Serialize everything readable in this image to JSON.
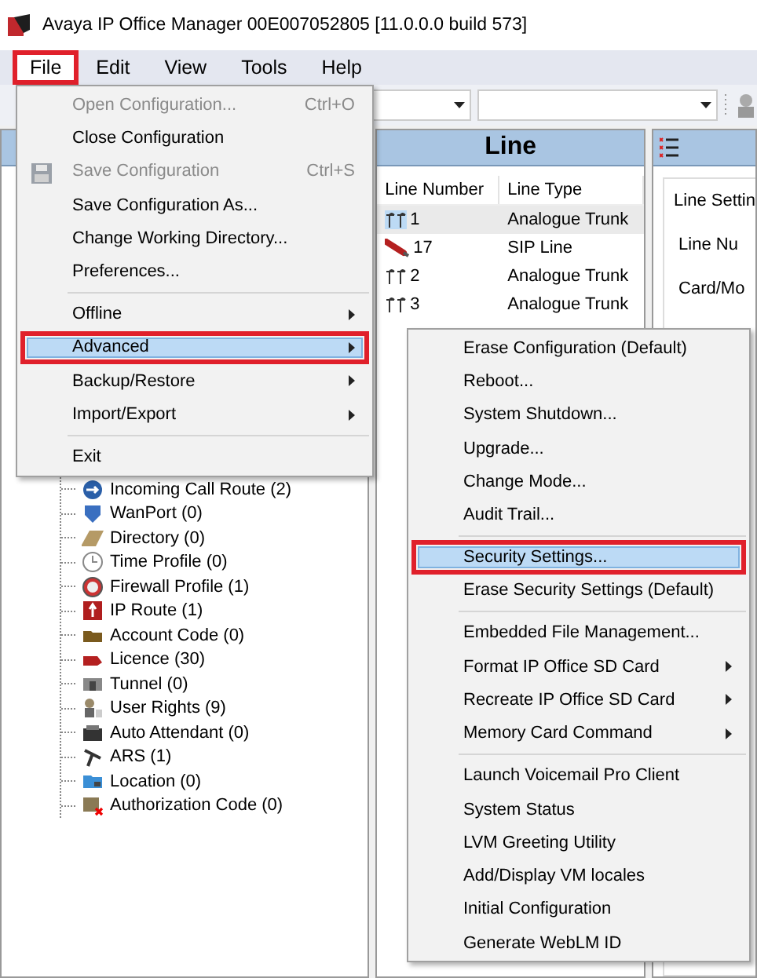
{
  "window": {
    "title": "Avaya IP Office Manager 00E007052805 [11.0.0.0 build 573]"
  },
  "menubar": [
    {
      "label": "File",
      "selected": true,
      "annotated": true
    },
    {
      "label": "Edit",
      "selected": false,
      "annotated": false
    },
    {
      "label": "View",
      "selected": false,
      "annotated": false
    },
    {
      "label": "Tools",
      "selected": false,
      "annotated": false
    },
    {
      "label": "Help",
      "selected": false,
      "annotated": false
    }
  ],
  "tree": {
    "items": [
      "Incoming Call Route (2)",
      "WanPort (0)",
      "Directory (0)",
      "Time Profile (0)",
      "Firewall Profile (1)",
      "IP Route (1)",
      "Account Code (0)",
      "Licence (30)",
      "Tunnel (0)",
      "User Rights (9)",
      "Auto Attendant (0)",
      "ARS (1)",
      "Location (0)",
      "Authorization Code (0)"
    ]
  },
  "line_panel": {
    "title": "Line",
    "columns": [
      "Line Number",
      "Line Type"
    ],
    "rows": [
      {
        "number": "1",
        "type": "Analogue Trunk",
        "kind": "analogue",
        "selected": true
      },
      {
        "number": "17",
        "type": "SIP Line",
        "kind": "sip",
        "selected": false
      },
      {
        "number": "2",
        "type": "Analogue Trunk",
        "kind": "analogue",
        "selected": false
      },
      {
        "number": "3",
        "type": "Analogue Trunk",
        "kind": "analogue",
        "selected": false
      }
    ]
  },
  "detail_panel": {
    "group_title": "Line Settin",
    "labels": [
      "Line Nu",
      "Card/Mo"
    ]
  },
  "file_menu": [
    {
      "kind": "item",
      "label": "Open Configuration...",
      "shortcut": "Ctrl+O",
      "disabled": true,
      "submenu": false,
      "selected": false,
      "annotated": false
    },
    {
      "kind": "item",
      "label": "Close Configuration",
      "disabled": false,
      "submenu": false,
      "selected": false,
      "annotated": false
    },
    {
      "kind": "icon_item",
      "label": "Save Configuration",
      "shortcut": "Ctrl+S",
      "disabled": true,
      "submenu": false,
      "selected": false,
      "annotated": false
    },
    {
      "kind": "item",
      "label": "Save Configuration As...",
      "disabled": false,
      "submenu": false,
      "selected": false,
      "annotated": false
    },
    {
      "kind": "item",
      "label": "Change Working Directory...",
      "disabled": false,
      "submenu": false,
      "selected": false,
      "annotated": false
    },
    {
      "kind": "item",
      "label": "Preferences...",
      "disabled": false,
      "submenu": false,
      "selected": false,
      "annotated": false
    },
    {
      "kind": "separator"
    },
    {
      "kind": "item",
      "label": "Offline",
      "disabled": false,
      "submenu": true,
      "selected": false,
      "annotated": false
    },
    {
      "kind": "item",
      "label": "Advanced",
      "disabled": false,
      "submenu": true,
      "selected": true,
      "annotated": true
    },
    {
      "kind": "item",
      "label": "Backup/Restore",
      "disabled": false,
      "submenu": true,
      "selected": false,
      "annotated": false
    },
    {
      "kind": "item",
      "label": "Import/Export",
      "disabled": false,
      "submenu": true,
      "selected": false,
      "annotated": false
    },
    {
      "kind": "separator"
    },
    {
      "kind": "item",
      "label": "Exit",
      "disabled": false,
      "submenu": false,
      "selected": false,
      "annotated": false
    }
  ],
  "advanced_menu": [
    {
      "kind": "item",
      "label": "Erase Configuration (Default)",
      "submenu": false,
      "selected": false,
      "annotated": false
    },
    {
      "kind": "item",
      "label": "Reboot...",
      "submenu": false,
      "selected": false,
      "annotated": false
    },
    {
      "kind": "item",
      "label": "System Shutdown...",
      "submenu": false,
      "selected": false,
      "annotated": false
    },
    {
      "kind": "item",
      "label": "Upgrade...",
      "submenu": false,
      "selected": false,
      "annotated": false
    },
    {
      "kind": "item",
      "label": "Change Mode...",
      "submenu": false,
      "selected": false,
      "annotated": false
    },
    {
      "kind": "item",
      "label": "Audit Trail...",
      "submenu": false,
      "selected": false,
      "annotated": false
    },
    {
      "kind": "separator"
    },
    {
      "kind": "item",
      "label": "Security Settings...",
      "submenu": false,
      "selected": true,
      "annotated": true
    },
    {
      "kind": "item",
      "label": "Erase Security Settings (Default)",
      "submenu": false,
      "selected": false,
      "annotated": false
    },
    {
      "kind": "separator"
    },
    {
      "kind": "item",
      "label": "Embedded File Management...",
      "submenu": false,
      "selected": false,
      "annotated": false
    },
    {
      "kind": "item",
      "label": "Format IP Office SD Card",
      "submenu": true,
      "selected": false,
      "annotated": false
    },
    {
      "kind": "item",
      "label": "Recreate IP Office SD Card",
      "submenu": true,
      "selected": false,
      "annotated": false
    },
    {
      "kind": "item",
      "label": "Memory Card Command",
      "submenu": true,
      "selected": false,
      "annotated": false
    },
    {
      "kind": "separator"
    },
    {
      "kind": "item",
      "label": "Launch Voicemail Pro Client",
      "submenu": false,
      "selected": false,
      "annotated": false
    },
    {
      "kind": "item",
      "label": "System Status",
      "submenu": false,
      "selected": false,
      "annotated": false
    },
    {
      "kind": "item",
      "label": "LVM Greeting Utility",
      "submenu": false,
      "selected": false,
      "annotated": false
    },
    {
      "kind": "item",
      "label": "Add/Display VM locales",
      "submenu": false,
      "selected": false,
      "annotated": false
    },
    {
      "kind": "item",
      "label": "Initial Configuration",
      "submenu": false,
      "selected": false,
      "annotated": false
    },
    {
      "kind": "item",
      "label": "Generate WebLM ID",
      "submenu": false,
      "selected": false,
      "annotated": false
    }
  ]
}
